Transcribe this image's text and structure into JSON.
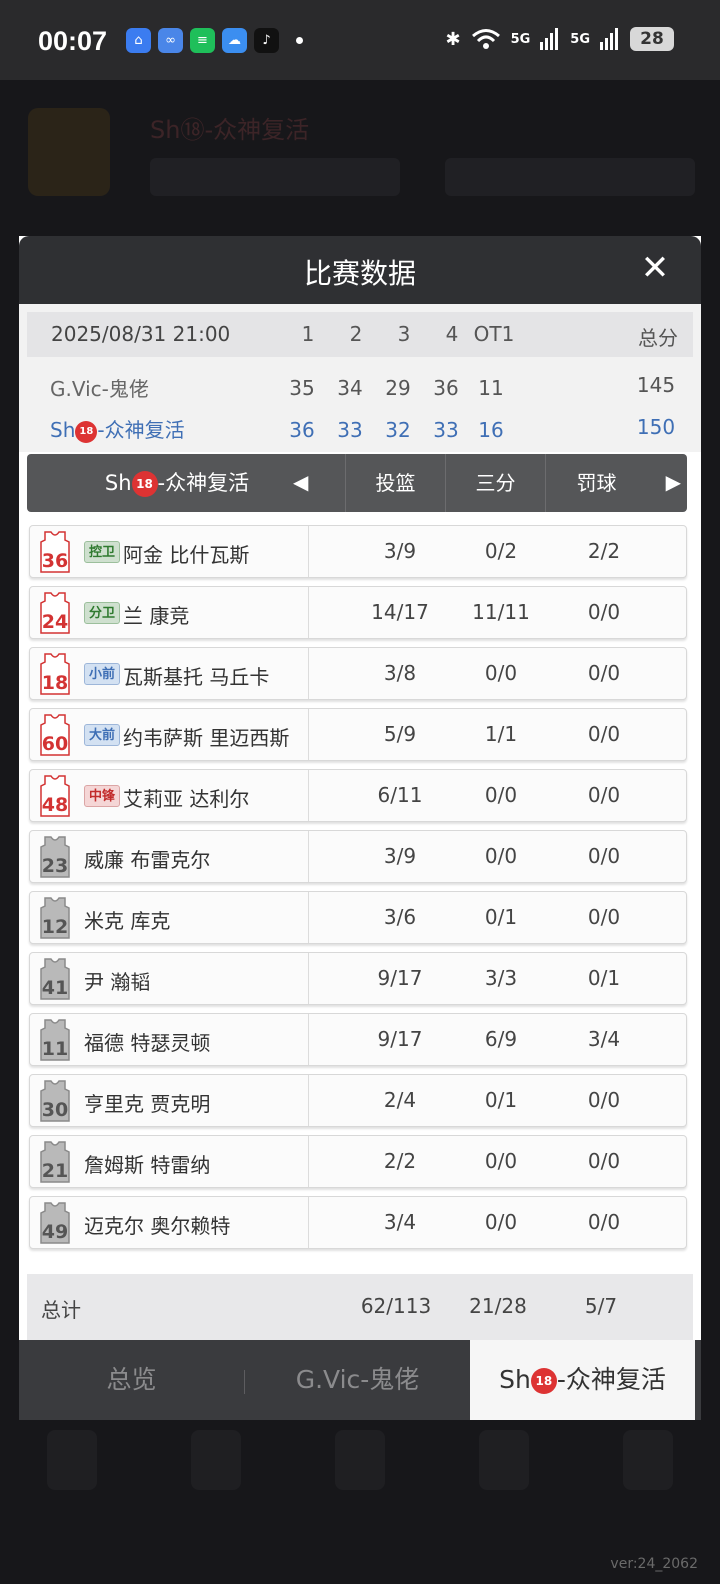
{
  "status_bar": {
    "time": "00:07",
    "battery": "28",
    "net1": "5G",
    "net2": "5G"
  },
  "background": {
    "team_name": "Sh⑱-众神复活"
  },
  "modal": {
    "title": "比赛数据",
    "close_icon": "close-icon",
    "score_header": {
      "date": "2025/08/31 21:00",
      "q1": "1",
      "q2": "2",
      "q3": "3",
      "q4": "4",
      "ot": "OT1",
      "total": "总分"
    },
    "teams": [
      {
        "name": "G.Vic-鬼佬",
        "q1": "35",
        "q2": "34",
        "q3": "29",
        "q4": "36",
        "ot": "11",
        "total": "145"
      },
      {
        "name_prefix": "Sh",
        "name_badge": "18",
        "name_suffix": "-众神复活",
        "q1": "36",
        "q2": "33",
        "q3": "32",
        "q4": "33",
        "ot": "16",
        "total": "150"
      }
    ],
    "stat_tab": {
      "team_prefix": "Sh",
      "team_badge": "18",
      "team_suffix": "-众神复活",
      "cols": [
        "投篮",
        "三分",
        "罚球"
      ]
    },
    "players": [
      {
        "number": "36",
        "pos": "控卫",
        "pos_color": "green",
        "name": "阿金 比什瓦斯",
        "fg": "3/9",
        "three": "0/2",
        "ft": "2/2",
        "starter": true
      },
      {
        "number": "24",
        "pos": "分卫",
        "pos_color": "green",
        "name": "兰 康竞",
        "fg": "14/17",
        "three": "11/11",
        "ft": "0/0",
        "starter": true
      },
      {
        "number": "18",
        "pos": "小前",
        "pos_color": "blue",
        "name": "瓦斯基托 马丘卡",
        "fg": "3/8",
        "three": "0/0",
        "ft": "0/0",
        "starter": true
      },
      {
        "number": "60",
        "pos": "大前",
        "pos_color": "blue",
        "name": "约韦萨斯 里迈西斯",
        "fg": "5/9",
        "three": "1/1",
        "ft": "0/0",
        "starter": true
      },
      {
        "number": "48",
        "pos": "中锋",
        "pos_color": "red",
        "name": "艾莉亚 达利尔",
        "fg": "6/11",
        "three": "0/0",
        "ft": "0/0",
        "starter": true
      },
      {
        "number": "23",
        "pos": "",
        "pos_color": "",
        "name": "威廉 布雷克尔",
        "fg": "3/9",
        "three": "0/0",
        "ft": "0/0",
        "starter": false
      },
      {
        "number": "12",
        "pos": "",
        "pos_color": "",
        "name": "米克 库克",
        "fg": "3/6",
        "three": "0/1",
        "ft": "0/0",
        "starter": false
      },
      {
        "number": "41",
        "pos": "",
        "pos_color": "",
        "name": "尹 瀚韬",
        "fg": "9/17",
        "three": "3/3",
        "ft": "0/1",
        "starter": false
      },
      {
        "number": "11",
        "pos": "",
        "pos_color": "",
        "name": "福德 特瑟灵顿",
        "fg": "9/17",
        "three": "6/9",
        "ft": "3/4",
        "starter": false
      },
      {
        "number": "30",
        "pos": "",
        "pos_color": "",
        "name": "亨里克 贾克明",
        "fg": "2/4",
        "three": "0/1",
        "ft": "0/0",
        "starter": false
      },
      {
        "number": "21",
        "pos": "",
        "pos_color": "",
        "name": "詹姆斯 特雷纳",
        "fg": "2/2",
        "three": "0/0",
        "ft": "0/0",
        "starter": false
      },
      {
        "number": "49",
        "pos": "",
        "pos_color": "",
        "name": "迈克尔 奥尔赖特",
        "fg": "3/4",
        "three": "0/0",
        "ft": "0/0",
        "starter": false
      }
    ],
    "total": {
      "label": "总计",
      "fg": "62/113",
      "three": "21/28",
      "ft": "5/7"
    },
    "bottom_tabs": [
      {
        "label": "总览"
      },
      {
        "label": "G.Vic-鬼佬"
      },
      {
        "label_prefix": "Sh",
        "label_badge": "18",
        "label_suffix": "-众神复活",
        "active": true
      }
    ]
  },
  "version": "ver:24_2062",
  "colors": {
    "accent_blue": "#3f6fb5",
    "starter_jersey": "#d33333",
    "bench_jersey": "#8a8a8a"
  }
}
